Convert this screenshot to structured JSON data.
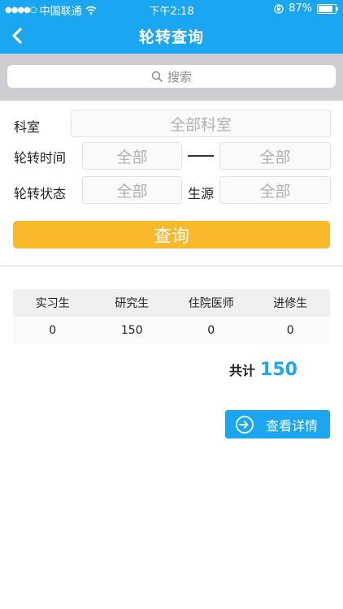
{
  "status_bar": {
    "carrier": "中国联通",
    "time": "下午2:18",
    "battery": "87%",
    "battery_level": 0.87,
    "icons": [
      "signal-dots-icon",
      "wifi-icon",
      "orientation-lock-icon",
      "battery-icon"
    ]
  },
  "nav": {
    "title": "轮转查询",
    "back_icon": "chevron-left-icon"
  },
  "search": {
    "placeholder": "搜索",
    "icon": "search-icon"
  },
  "form": {
    "department_label": "科室",
    "department_value": "全部科室",
    "time_label": "轮转时间",
    "time_start": "全部",
    "time_end": "全部",
    "status_label": "轮转状态",
    "status_value": "全部",
    "source_label": "生源",
    "source_value": "全部",
    "query_button": "查询"
  },
  "stats": {
    "headers": [
      "实习生",
      "研究生",
      "住院医师",
      "进修生"
    ],
    "values": [
      "0",
      "150",
      "0",
      "0"
    ]
  },
  "total": {
    "label": "共计",
    "value": "150"
  },
  "detail_button": {
    "label": "查看详情",
    "icon": "arrow-enter-icon"
  },
  "colors": {
    "primary": "#1aa6f0",
    "query_button": "#f9b92a"
  }
}
